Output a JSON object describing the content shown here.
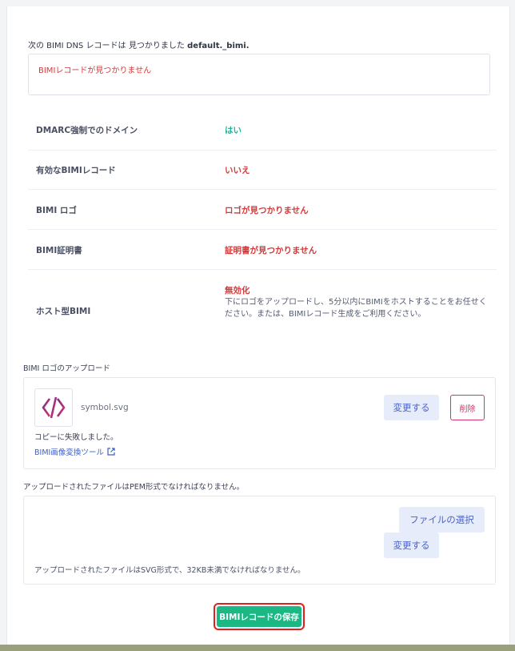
{
  "dns": {
    "heading_prefix": "次の BIMI DNS レコードは",
    "heading_middle": "見つかりました",
    "heading_record": "default._bimi.",
    "error": "BIMIレコードが見つかりません"
  },
  "status_rows": [
    {
      "label": "DMARC強制でのドメイン",
      "value": "はい"
    },
    {
      "label": "有効なBIMIレコード",
      "value": "いいえ"
    },
    {
      "label": "BIMI ロゴ",
      "value": "ロゴが見つかりません"
    },
    {
      "label": "BIMI証明書",
      "value": "証明書が見つかりません"
    },
    {
      "label": "ホスト型BIMI",
      "value": "無効化",
      "description": "下にロゴをアップロードし、5分以内にBIMIをホストすることをお任せください。または、BIMIレコード生成をご利用ください。"
    }
  ],
  "logo_upload": {
    "section_label": "BIMI ロゴのアップロード",
    "file_name": "symbol.svg",
    "change_label": "変更する",
    "delete_label": "削除",
    "copy_failed": "コピーに失敗しました。",
    "tool_link": "BIMI画像変換ツール"
  },
  "cert_upload": {
    "section_label": "アップロードされたファイルはPEM形式でなければなりません。",
    "choose_file_label": "ファイルの選択",
    "change_label": "変更する",
    "svg_note": "アップロードされたファイルはSVG形式で、32KB未満でなければなりません。"
  },
  "save": {
    "label": "BIMIレコードの保存"
  },
  "colors": {
    "ok": "#24b39a",
    "bad": "#d33a3a",
    "primary": "#1bb884",
    "highlight": "#e0201b"
  }
}
